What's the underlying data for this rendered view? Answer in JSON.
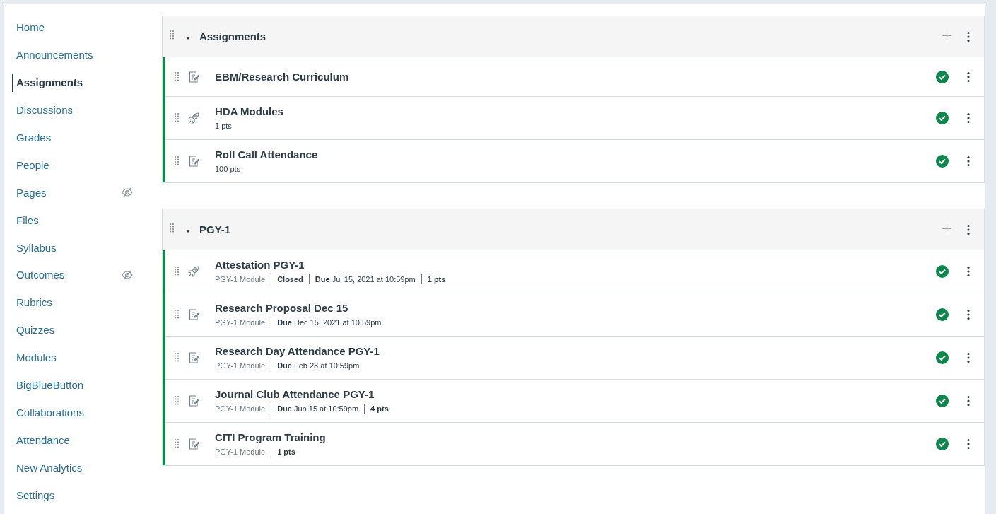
{
  "sidebar": {
    "items": [
      {
        "label": "Home",
        "selected": false,
        "hidden": false
      },
      {
        "label": "Announcements",
        "selected": false,
        "hidden": false
      },
      {
        "label": "Assignments",
        "selected": true,
        "hidden": false
      },
      {
        "label": "Discussions",
        "selected": false,
        "hidden": false
      },
      {
        "label": "Grades",
        "selected": false,
        "hidden": false
      },
      {
        "label": "People",
        "selected": false,
        "hidden": false
      },
      {
        "label": "Pages",
        "selected": false,
        "hidden": true
      },
      {
        "label": "Files",
        "selected": false,
        "hidden": false
      },
      {
        "label": "Syllabus",
        "selected": false,
        "hidden": false
      },
      {
        "label": "Outcomes",
        "selected": false,
        "hidden": true
      },
      {
        "label": "Rubrics",
        "selected": false,
        "hidden": false
      },
      {
        "label": "Quizzes",
        "selected": false,
        "hidden": false
      },
      {
        "label": "Modules",
        "selected": false,
        "hidden": false
      },
      {
        "label": "BigBlueButton",
        "selected": false,
        "hidden": false
      },
      {
        "label": "Collaborations",
        "selected": false,
        "hidden": false
      },
      {
        "label": "Attendance",
        "selected": false,
        "hidden": false
      },
      {
        "label": "New Analytics",
        "selected": false,
        "hidden": false
      },
      {
        "label": "Settings",
        "selected": false,
        "hidden": false
      }
    ]
  },
  "groups": [
    {
      "title": "Assignments",
      "expanded": true,
      "items": [
        {
          "kind": "assignment",
          "title": "EBM/Research Curriculum",
          "published": true
        },
        {
          "kind": "quiz",
          "title": "HDA Modules",
          "published": true,
          "meta": [
            {
              "kind": "points",
              "text": "1 pts"
            }
          ]
        },
        {
          "kind": "assignment",
          "title": "Roll Call Attendance",
          "published": true,
          "meta": [
            {
              "kind": "points",
              "text": "100 pts"
            }
          ]
        }
      ]
    },
    {
      "title": "PGY-1",
      "expanded": true,
      "items": [
        {
          "kind": "quiz",
          "title": "Attestation PGY-1",
          "published": true,
          "meta": [
            {
              "kind": "module",
              "text": "PGY-1 Module"
            },
            {
              "kind": "status",
              "text": "Closed"
            },
            {
              "kind": "due",
              "label": "Due",
              "text": "Jul 15, 2021 at 10:59pm"
            },
            {
              "kind": "points",
              "text": "1 pts"
            }
          ]
        },
        {
          "kind": "assignment",
          "title": "Research Proposal Dec 15",
          "published": true,
          "meta": [
            {
              "kind": "module",
              "text": "PGY-1 Module"
            },
            {
              "kind": "due",
              "label": "Due",
              "text": "Dec 15, 2021 at 10:59pm"
            }
          ]
        },
        {
          "kind": "assignment",
          "title": "Research Day Attendance PGY-1",
          "published": true,
          "meta": [
            {
              "kind": "module",
              "text": "PGY-1 Module"
            },
            {
              "kind": "due",
              "label": "Due",
              "text": "Feb 23 at 10:59pm"
            }
          ]
        },
        {
          "kind": "assignment",
          "title": "Journal Club Attendance PGY-1",
          "published": true,
          "meta": [
            {
              "kind": "module",
              "text": "PGY-1 Module"
            },
            {
              "kind": "due",
              "label": "Due",
              "text": "Jun 15 at 10:59pm"
            },
            {
              "kind": "points",
              "text": "4 pts"
            }
          ]
        },
        {
          "kind": "assignment",
          "title": "CITI Program Training",
          "published": true,
          "meta": [
            {
              "kind": "module",
              "text": "PGY-1 Module"
            },
            {
              "kind": "points",
              "text": "1 pts"
            }
          ]
        }
      ]
    }
  ]
}
